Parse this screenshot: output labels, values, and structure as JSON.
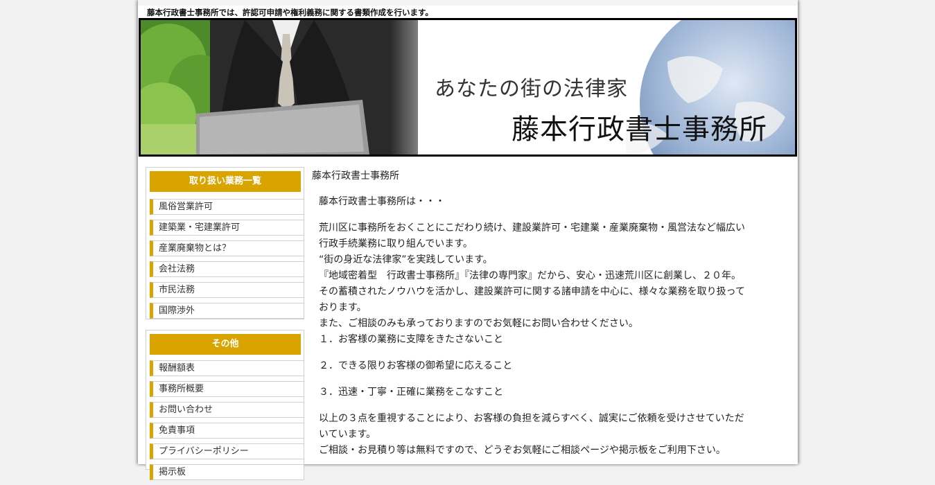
{
  "header": {
    "tagline": "藤本行政書士事務所では、許認可申請や権利義務に関する書類作成を行います。",
    "banner_sub": "あなたの街の法律家",
    "banner_main": "藤本行政書士事務所"
  },
  "sidebar": {
    "section1": {
      "title": "取り扱い業務一覧",
      "items": [
        "風俗営業許可",
        "建築業・宅建業許可",
        "産業廃棄物とは？",
        "会社法務",
        "市民法務",
        "国際渉外"
      ]
    },
    "section2": {
      "title": "その他",
      "items": [
        "報酬額表",
        "事務所概要",
        "お問い合わせ",
        "免責事項",
        "プライバシーポリシー",
        "掲示板"
      ]
    }
  },
  "main": {
    "title": "藤本行政書士事務所",
    "intro": "藤本行政書士事務所は・・・",
    "body": [
      "荒川区に事務所をおくことにこだわり続け、建設業許可・宅建業・産業廃棄物・風営法など幅広い",
      "行政手続業務に取り組んでいます。",
      "“街の身近な法律家”を実践しています。",
      "『地域密着型　行政書士事務所』『法律の専門家』だから、安心・迅速荒川区に創業し、２０年。",
      "その蓄積されたノウハウを活かし、建設業許可に関する諸申請を中心に、様々な業務を取り扱って",
      "おります。",
      "また、ご相談のみも承っておりますのでお気軽にお問い合わせください。",
      "１．お客様の業務に支障をきたさないこと"
    ],
    "point2": "２．できる限りお客様の御希望に応えること",
    "point3": "３．迅速・丁寧・正確に業務をこなすこと",
    "closing": [
      "以上の３点を重視することにより、お客様の負担を減らすべく、誠実にご依頼を受けさせていただ",
      "いています。",
      "ご相談・お見積り等は無料ですので、どうぞお気軽にご相談ページや掲示板をご利用下さい。"
    ]
  },
  "colors": {
    "accent": "#d9a400",
    "page_bg": "#f2f2f2"
  }
}
